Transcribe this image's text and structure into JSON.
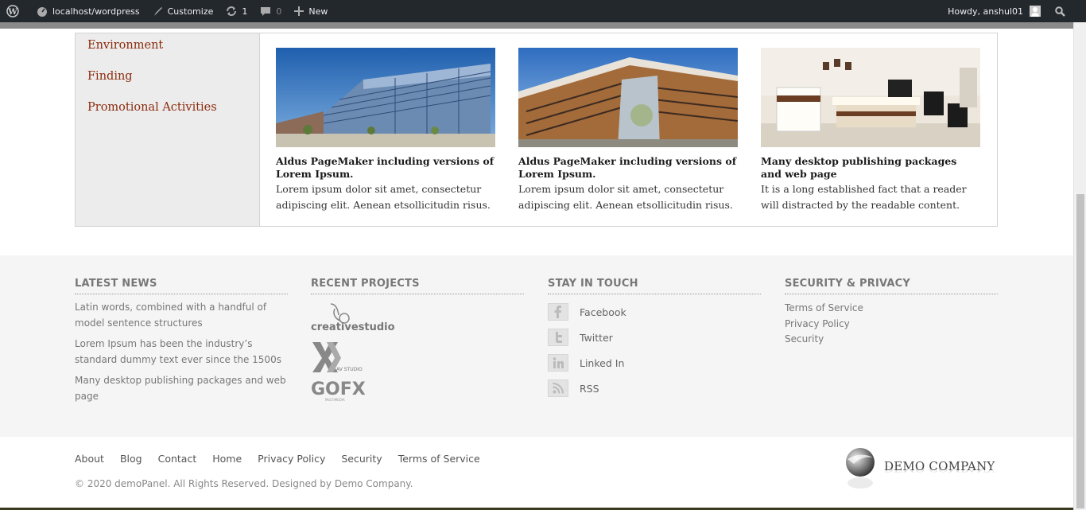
{
  "adminbar": {
    "site": "localhost/wordpress",
    "customize": "Customize",
    "updates_count": "1",
    "comments_count": "0",
    "new_label": "New",
    "howdy": "Howdy, anshul01"
  },
  "sidebar": {
    "categories": [
      "Environment",
      "Finding",
      "Promotional Activities"
    ]
  },
  "posts": [
    {
      "title": "Aldus PageMaker including versions of Lorem Ipsum.",
      "excerpt": "Lorem ipsum dolor sit amet, consectetur adipiscing elit. Aenean etsollicitudin risus."
    },
    {
      "title": "Aldus PageMaker including versions of Lorem Ipsum.",
      "excerpt": "Lorem ipsum dolor sit amet, consectetur adipiscing elit. Aenean etsollicitudin risus."
    },
    {
      "title": "Many desktop publishing packages and web page",
      "excerpt": "It is a long established fact that a reader will distracted by the readable content."
    }
  ],
  "footer": {
    "latest_news": {
      "title": "LATEST NEWS",
      "items": [
        "Latin words, combined with a handful of model sentence structures",
        "Lorem Ipsum has been the industry’s standard dummy text ever since the 1500s",
        "Many desktop publishing packages and web page"
      ]
    },
    "recent_projects": {
      "title": "RECENT PROJECTS",
      "logos": [
        "creativestudio",
        "AV STUDIO",
        "GOFX",
        "MULTIMEDIA"
      ]
    },
    "stay_in_touch": {
      "title": "STAY IN TOUCH",
      "links": [
        "Facebook",
        "Twitter",
        "Linked In",
        "RSS"
      ]
    },
    "security": {
      "title": "SECURITY & PRIVACY",
      "links": [
        "Terms of Service",
        "Privacy Policy",
        "Security"
      ]
    }
  },
  "bottom": {
    "nav": [
      "About",
      "Blog",
      "Contact",
      "Home",
      "Privacy Policy",
      "Security",
      "Terms of Service"
    ],
    "copyright": "© 2020 demoPanel. All Rights Reserved. Designed by Demo Company.",
    "company": "DEMO COMPANY"
  },
  "colors": {
    "adminbar_bg": "#23282d",
    "category_link": "#8b2a0c",
    "footer_bg": "#f5f5f5"
  }
}
